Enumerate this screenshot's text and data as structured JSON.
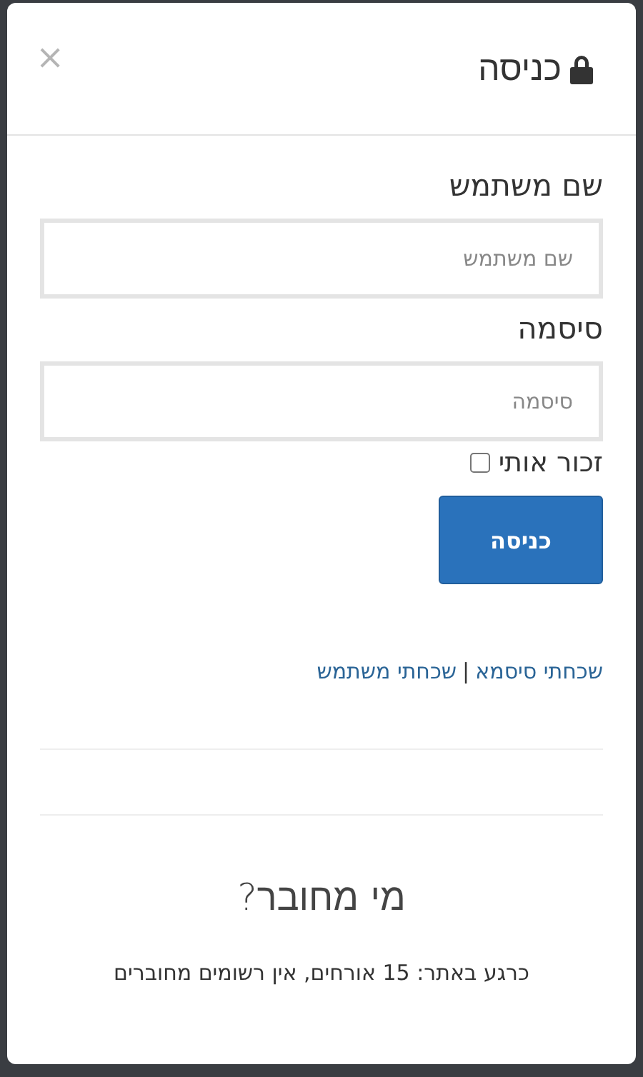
{
  "modal": {
    "title": "כניסה",
    "close": "×"
  },
  "form": {
    "username_label": "שם משתמש",
    "username": {
      "placeholder": "שם משתמש"
    },
    "password_label": "סיסמה",
    "password": {
      "placeholder": "סיסמה"
    },
    "remember": {
      "label": "זכור אותי",
      "checked": false
    },
    "submit": "כניסה"
  },
  "links": [
    {
      "label": "שכחתי סיסמא"
    },
    {
      "label": "שכחתי משתמש"
    }
  ],
  "link_separator": "|",
  "who_online": {
    "title": "מי מחובר?",
    "text": "כרגע באתר: 15 אורחים, אין רשומים מחוברים"
  }
}
